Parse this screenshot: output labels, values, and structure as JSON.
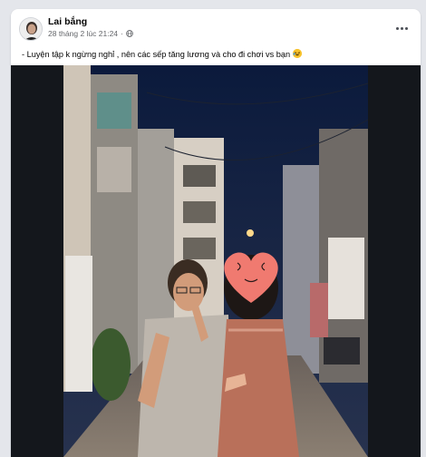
{
  "post": {
    "author_name": "Lai bắng",
    "timestamp": "28 tháng 2 lúc 21:24",
    "visibility_icon": "globe-icon",
    "text": "- Luyện tập k ngừng nghỉ , nên các sếp tăng lương và cho đi chơi vs bạn",
    "text_emoji": "laughing-emoji",
    "more_icon": "more-horizontal-icon"
  },
  "colors": {
    "card_bg": "#ffffff",
    "page_bg": "#e4e6eb",
    "name_color": "#050505",
    "meta_color": "#65676b",
    "heart_sticker": "#f07a70"
  }
}
